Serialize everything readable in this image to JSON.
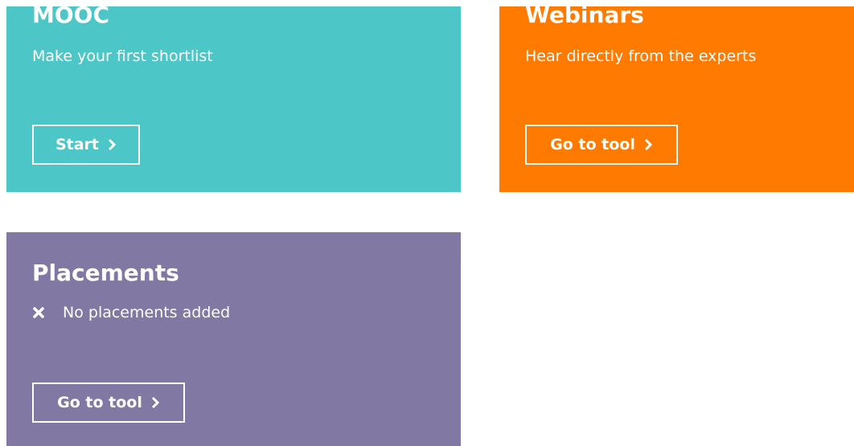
{
  "cards": {
    "mooc": {
      "title": "MOOC",
      "subtitle": "Make your first shortlist",
      "button_label": "Start",
      "color": "#4CC6C6"
    },
    "webinars": {
      "title": "Webinars",
      "subtitle": "Hear directly from the experts",
      "button_label": "Go to tool",
      "color": "#FF7A00"
    },
    "placements": {
      "title": "Placements",
      "status_text": "No placements added",
      "status_icon": "close-icon",
      "button_label": "Go to tool",
      "color": "#8179A4"
    }
  },
  "icons": {
    "button": "chevron-right-icon"
  }
}
